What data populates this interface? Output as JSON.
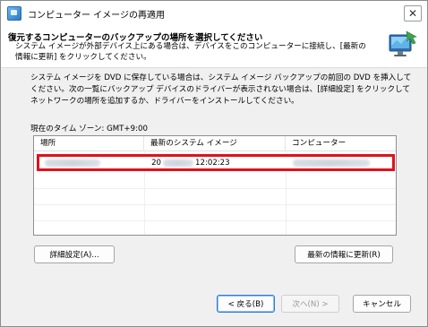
{
  "window": {
    "title": "コンピューター イメージの再適用",
    "close_symbol": "✕"
  },
  "header": {
    "title": "復元するコンピューターのバックアップの場所を選択してください",
    "description": "システム イメージが外部デバイス上にある場合は、デバイスをこのコンピューターに接続し、[最新の情報に更新] をクリックしてください。",
    "icon": "restore-computer-icon"
  },
  "body": {
    "instructions": "システム イメージを DVD に保存している場合は、システム イメージ バックアップの前回の DVD を挿入してください。次の一覧にバックアップ デバイスのドライバーが表示されない場合は、[詳細設定] をクリックしてネットワークの場所を追加するか、ドライバーをインストールしてください。",
    "timezone": "現在のタイム ゾーン: GMT+9:00"
  },
  "table": {
    "columns": [
      "場所",
      "最新のシステム イメージ",
      "コンピューター"
    ],
    "rows": [
      {
        "location": "",
        "latest_image_prefix": "20",
        "latest_image_time": "12:02:23",
        "computer": "",
        "selected": true
      }
    ]
  },
  "buttons": {
    "advanced": "詳細設定(A)...",
    "refresh": "最新の情報に更新(R)",
    "back": "< 戻る(B)",
    "next": "次へ(N) >",
    "cancel": "キャンセル"
  },
  "colors": {
    "highlight_border": "#e0111b",
    "focus_border": "#2e7bd6"
  }
}
